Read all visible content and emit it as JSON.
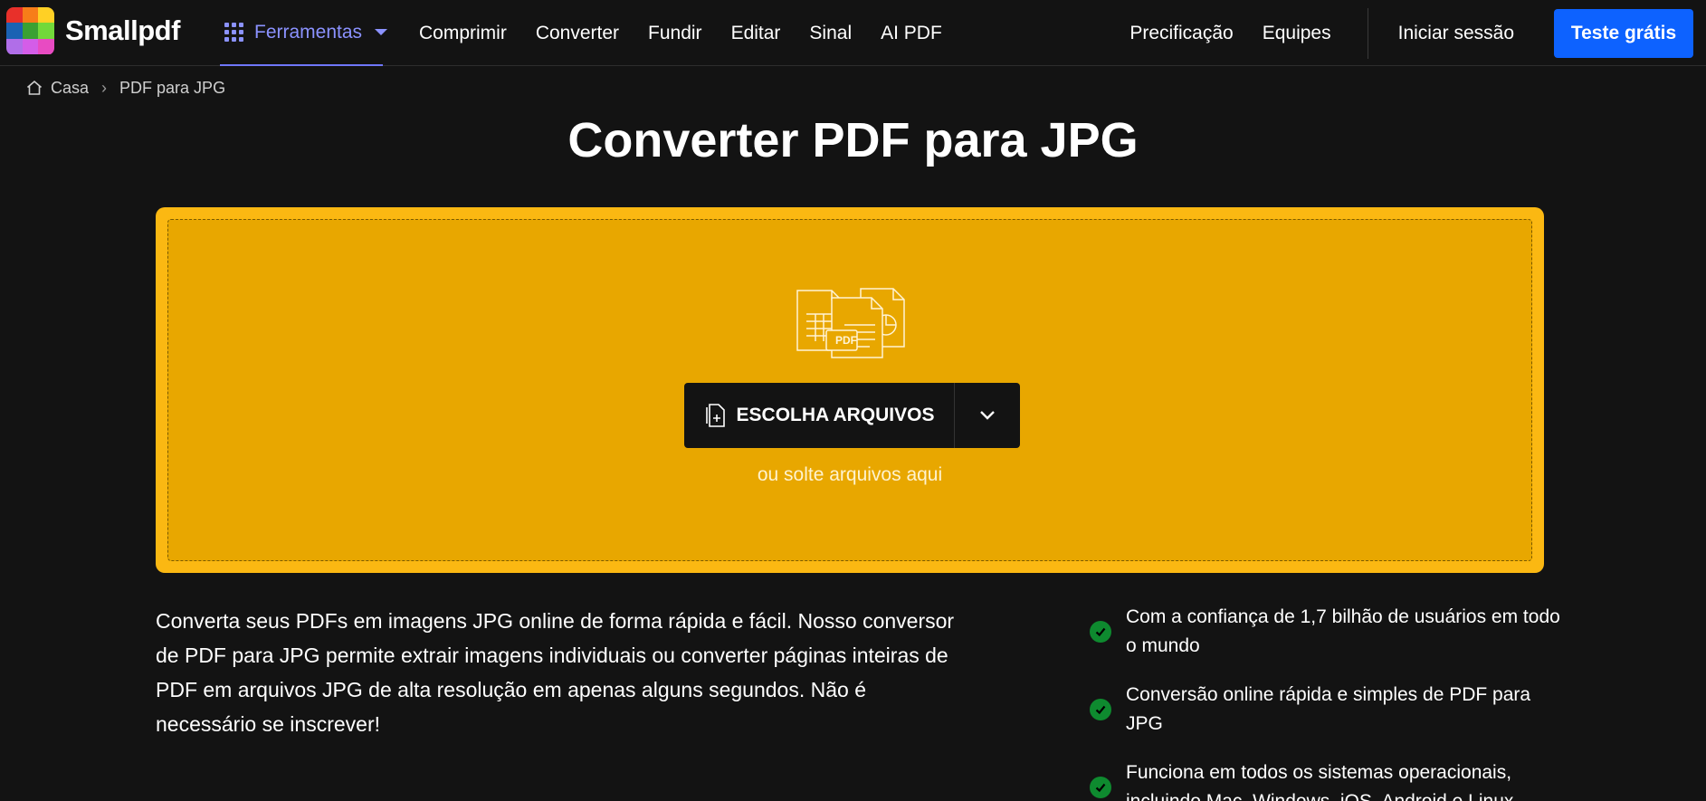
{
  "nav": {
    "logo_text": "Smallpdf",
    "logo_colors": [
      "#e8302a",
      "#f77d19",
      "#ffd025",
      "#1b62b3",
      "#3aa133",
      "#72d93a",
      "#b06ee8",
      "#d45de8",
      "#e84bc2"
    ],
    "tools_label": "Ferramentas",
    "links": [
      "Comprimir",
      "Converter",
      "Fundir",
      "Editar",
      "Sinal",
      "AI PDF"
    ],
    "pricing": "Precificação",
    "teams": "Equipes",
    "signin": "Iniciar sessão",
    "trial": "Teste grátis",
    "accent": "#0d62ff"
  },
  "breadcrumb": {
    "home": "Casa",
    "separator": "›",
    "current": "PDF para JPG"
  },
  "page_title": "Converter PDF para JPG",
  "dropzone": {
    "file_badge": "PDF",
    "choose_label": "ESCOLHA ARQUIVOS",
    "drop_hint": "ou solte arquivos aqui",
    "outer_color": "#fbb812",
    "inner_color": "#e8a700"
  },
  "description": "Converta seus PDFs em imagens JPG online de forma rápida e fácil. Nosso conversor de PDF para JPG permite extrair imagens individuais ou converter páginas inteiras de PDF em arquivos JPG de alta resolução em apenas alguns segundos. Não é necessário se inscrever!",
  "features": [
    "Com a confiança de 1,7 bilhão de usuários em todo o mundo",
    "Conversão online rápida e simples de PDF para JPG",
    "Funciona em todos os sistemas operacionais, incluindo Mac, Windows, iOS, Android e Linux"
  ]
}
